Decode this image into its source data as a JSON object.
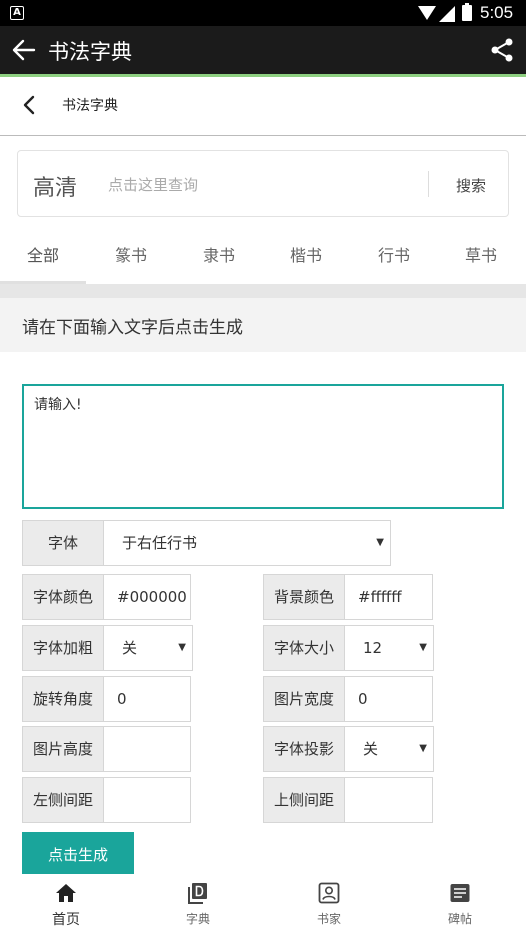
{
  "status_bar": {
    "time": "5:05",
    "notification_letter": "A"
  },
  "app_bar": {
    "title": "书法字典",
    "back_icon": "arrow-left-icon",
    "share_icon": "share-icon"
  },
  "sub_header": {
    "title": "书法字典",
    "back_icon": "chevron-left-icon"
  },
  "search": {
    "quality_label": "高清",
    "placeholder": "点击这里查询",
    "button_label": "搜索"
  },
  "tabs": [
    {
      "label": "全部",
      "active": true
    },
    {
      "label": "篆书",
      "active": false
    },
    {
      "label": "隶书",
      "active": false
    },
    {
      "label": "楷书",
      "active": false
    },
    {
      "label": "行书",
      "active": false
    },
    {
      "label": "草书",
      "active": false
    }
  ],
  "prompt_text": "请在下面输入文字后点击生成",
  "input": {
    "placeholder": "请输入!"
  },
  "form": {
    "font": {
      "label": "字体",
      "value": "于右任行书"
    },
    "font_color": {
      "label": "字体颜色",
      "value": "#000000"
    },
    "bg_color": {
      "label": "背景颜色",
      "value": "#ffffff"
    },
    "bold": {
      "label": "字体加粗",
      "value": "关"
    },
    "font_size": {
      "label": "字体大小",
      "value": "12"
    },
    "rotation": {
      "label": "旋转角度",
      "value": "0"
    },
    "image_width": {
      "label": "图片宽度",
      "value": "0"
    },
    "image_height": {
      "label": "图片高度",
      "value": ""
    },
    "shadow": {
      "label": "字体投影",
      "value": "关"
    },
    "left_margin": {
      "label": "左侧间距",
      "value": ""
    },
    "top_margin": {
      "label": "上侧间距",
      "value": ""
    }
  },
  "generate_button": "点击生成",
  "bottom_nav": [
    {
      "label": "首页",
      "icon": "home-icon",
      "active": true
    },
    {
      "label": "字典",
      "icon": "dictionary-icon",
      "active": false
    },
    {
      "label": "书家",
      "icon": "calligrapher-icon",
      "active": false
    },
    {
      "label": "碑帖",
      "icon": "rubbing-icon",
      "active": false
    }
  ],
  "colors": {
    "accent": "#1aa59b",
    "app_bar": "#1b1b1b",
    "highlight_line": "#8ed081"
  }
}
